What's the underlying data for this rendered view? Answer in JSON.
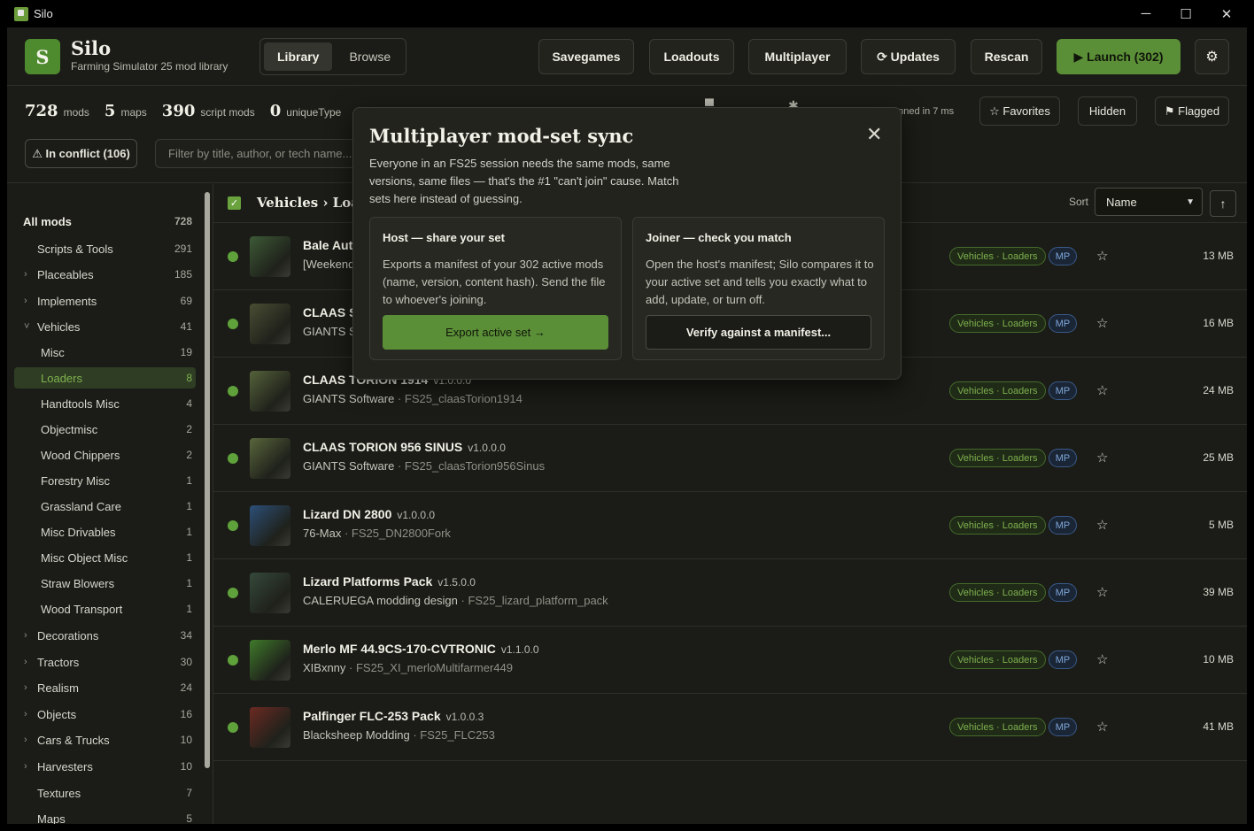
{
  "window": {
    "title": "Silo",
    "controls": {
      "minimize": "─",
      "maximize": "☐",
      "close": "✕"
    }
  },
  "header": {
    "logo_letter": "S",
    "title": "Silo",
    "subtitle": "Farming Simulator 25 mod library",
    "tabs": [
      {
        "label": "Library",
        "active": true
      },
      {
        "label": "Browse",
        "active": false
      }
    ],
    "buttons": {
      "savegames": "Savegames",
      "loadouts": "Loadouts",
      "multiplayer": "Multiplayer",
      "updates": "⟳ Updates",
      "rescan": "Rescan",
      "launch": "▶ Launch (302)",
      "settings": "⚙"
    }
  },
  "stats": [
    {
      "value": "728",
      "label": "mods"
    },
    {
      "value": "5",
      "label": "maps"
    },
    {
      "value": "390",
      "label": "script mods"
    },
    {
      "value": "0",
      "label": "uniqueType"
    }
  ],
  "scanned_text": "anned in 7 ms",
  "filters": {
    "favorites": "☆ Favorites",
    "hidden": "Hidden",
    "flagged": "⚑ Flagged"
  },
  "conflict_label": "⚠ In conflict (106)",
  "search": {
    "placeholder": "Filter by title, author, or tech name..."
  },
  "sidebar": {
    "items": [
      {
        "label": "All mods",
        "count": "728",
        "indent": 0,
        "chevron": "",
        "active": false,
        "bold": true
      },
      {
        "label": "Scripts & Tools",
        "count": "291",
        "indent": 1,
        "chevron": "",
        "active": false,
        "bold": false
      },
      {
        "label": "Placeables",
        "count": "185",
        "indent": 1,
        "chevron": "›",
        "active": false,
        "bold": false
      },
      {
        "label": "Implements",
        "count": "69",
        "indent": 1,
        "chevron": "›",
        "active": false,
        "bold": false
      },
      {
        "label": "Vehicles",
        "count": "41",
        "indent": 1,
        "chevron": "˅",
        "active": false,
        "bold": false
      },
      {
        "label": "Misc",
        "count": "19",
        "indent": 2,
        "chevron": "",
        "active": false,
        "bold": false
      },
      {
        "label": "Loaders",
        "count": "8",
        "indent": 2,
        "chevron": "",
        "active": true,
        "bold": false
      },
      {
        "label": "Handtools Misc",
        "count": "4",
        "indent": 2,
        "chevron": "",
        "active": false,
        "bold": false
      },
      {
        "label": "Objectmisc",
        "count": "2",
        "indent": 2,
        "chevron": "",
        "active": false,
        "bold": false
      },
      {
        "label": "Wood Chippers",
        "count": "2",
        "indent": 2,
        "chevron": "",
        "active": false,
        "bold": false
      },
      {
        "label": "Forestry Misc",
        "count": "1",
        "indent": 2,
        "chevron": "",
        "active": false,
        "bold": false
      },
      {
        "label": "Grassland Care",
        "count": "1",
        "indent": 2,
        "chevron": "",
        "active": false,
        "bold": false
      },
      {
        "label": "Misc Drivables",
        "count": "1",
        "indent": 2,
        "chevron": "",
        "active": false,
        "bold": false
      },
      {
        "label": "Misc Object Misc",
        "count": "1",
        "indent": 2,
        "chevron": "",
        "active": false,
        "bold": false
      },
      {
        "label": "Straw Blowers",
        "count": "1",
        "indent": 2,
        "chevron": "",
        "active": false,
        "bold": false
      },
      {
        "label": "Wood Transport",
        "count": "1",
        "indent": 2,
        "chevron": "",
        "active": false,
        "bold": false
      },
      {
        "label": "Decorations",
        "count": "34",
        "indent": 1,
        "chevron": "›",
        "active": false,
        "bold": false
      },
      {
        "label": "Tractors",
        "count": "30",
        "indent": 1,
        "chevron": "›",
        "active": false,
        "bold": false
      },
      {
        "label": "Realism",
        "count": "24",
        "indent": 1,
        "chevron": "›",
        "active": false,
        "bold": false
      },
      {
        "label": "Objects",
        "count": "16",
        "indent": 1,
        "chevron": "›",
        "active": false,
        "bold": false
      },
      {
        "label": "Cars & Trucks",
        "count": "10",
        "indent": 1,
        "chevron": "›",
        "active": false,
        "bold": false
      },
      {
        "label": "Harvesters",
        "count": "10",
        "indent": 1,
        "chevron": "›",
        "active": false,
        "bold": false
      },
      {
        "label": "Textures",
        "count": "7",
        "indent": 1,
        "chevron": "",
        "active": false,
        "bold": false
      },
      {
        "label": "Maps",
        "count": "5",
        "indent": 1,
        "chevron": "",
        "active": false,
        "bold": false
      }
    ]
  },
  "list": {
    "select_all": "✓",
    "breadcrumb": "Vehicles › Loaders",
    "sort_label": "Sort",
    "sort_value": "Name",
    "sort_dir": "↑",
    "rows": [
      {
        "title": "Bale Autoload",
        "version": "",
        "author": "[Weekend",
        "tech": "",
        "tag": "Vehicles · Loaders",
        "mp": "MP",
        "size": "13 MB",
        "thumb": "#3d5a36"
      },
      {
        "title": "CLAAS SCORPION",
        "version": "",
        "author": "GIANTS Software",
        "tech": "",
        "tag": "Vehicles · Loaders",
        "mp": "MP",
        "size": "16 MB",
        "thumb": "#4a4d33"
      },
      {
        "title": "CLAAS TORION 1914",
        "version": "v1.0.0.0",
        "author": "GIANTS Software",
        "tech": "FS25_claasTorion1914",
        "tag": "Vehicles · Loaders",
        "mp": "MP",
        "size": "24 MB",
        "thumb": "#55623a"
      },
      {
        "title": "CLAAS TORION 956 SINUS",
        "version": "v1.0.0.0",
        "author": "GIANTS Software",
        "tech": "FS25_claasTorion956Sinus",
        "tag": "Vehicles · Loaders",
        "mp": "MP",
        "size": "25 MB",
        "thumb": "#59663c"
      },
      {
        "title": "Lizard DN 2800",
        "version": "v1.0.0.0",
        "author": "76-Max",
        "tech": "FS25_DN2800Fork",
        "tag": "Vehicles · Loaders",
        "mp": "MP",
        "size": "5 MB",
        "thumb": "#2c4f78"
      },
      {
        "title": "Lizard Platforms Pack",
        "version": "v1.5.0.0",
        "author": "CALERUEGA modding design",
        "tech": "FS25_lizard_platform_pack",
        "tag": "Vehicles · Loaders",
        "mp": "MP",
        "size": "39 MB",
        "thumb": "#35493a"
      },
      {
        "title": "Merlo MF 44.9CS-170-CVTRONIC",
        "version": "v1.1.0.0",
        "author": "XIBxnny",
        "tech": "FS25_XI_merloMultifarmer449",
        "tag": "Vehicles · Loaders",
        "mp": "MP",
        "size": "10 MB",
        "thumb": "#3f7a2a"
      },
      {
        "title": "Palfinger FLC-253 Pack",
        "version": "v1.0.0.3",
        "author": "Blacksheep Modding",
        "tech": "FS25_FLC253",
        "tag": "Vehicles · Loaders",
        "mp": "MP",
        "size": "41 MB",
        "thumb": "#6b2a22"
      }
    ]
  },
  "modal": {
    "title": "Multiplayer mod-set sync",
    "close": "✕",
    "description": "Everyone in an FS25 session needs the same mods, same versions, same files — that's the #1 \"can't join\" cause. Match sets here instead of guessing.",
    "host": {
      "title": "Host — share your set",
      "text": "Exports a manifest of your 302 active mods (name, version, content hash). Send the file to whoever's joining.",
      "button": "Export active set →"
    },
    "joiner": {
      "title": "Joiner — check you match",
      "text": "Open the host's manifest; Silo compares it to your active set and tells you exactly what to add, update, or turn off.",
      "button": "Verify against a manifest..."
    }
  },
  "colors": {
    "accent": "#5a8f37",
    "active_text": "#7fb24e",
    "background": "#1b1c17",
    "mp": "#7ea6d9"
  }
}
